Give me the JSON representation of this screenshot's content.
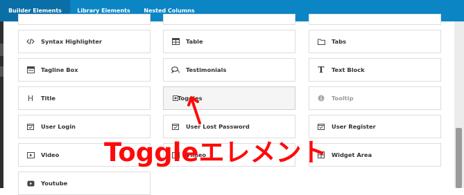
{
  "tabs": [
    {
      "label": "Builder Elements",
      "active": true
    },
    {
      "label": "Library Elements",
      "active": false
    },
    {
      "label": "Nested Columns",
      "active": false
    }
  ],
  "elements": [
    {
      "label": "Syntax Highlighter",
      "icon": "code-icon"
    },
    {
      "label": "Table",
      "icon": "table-icon"
    },
    {
      "label": "Tabs",
      "icon": "folder-icon"
    },
    {
      "label": "Tagline Box",
      "icon": "tagline-box-icon"
    },
    {
      "label": "Testimonials",
      "icon": "speech-bubbles-icon"
    },
    {
      "label": "Text Block",
      "icon": "text-t-icon"
    },
    {
      "label": "Title",
      "icon": "heading-h-icon"
    },
    {
      "label": "Toggles",
      "icon": "toggle-square-icon"
    },
    {
      "label": "Tooltip",
      "icon": "info-circle-icon"
    },
    {
      "label": "User Login",
      "icon": "calendar-check-icon"
    },
    {
      "label": "User Lost Password",
      "icon": "calendar-check-icon"
    },
    {
      "label": "User Register",
      "icon": "calendar-check-icon"
    },
    {
      "label": "Video",
      "icon": "video-icon"
    },
    {
      "label": "Vimeo",
      "icon": "vimeo-icon"
    },
    {
      "label": "Widget Area",
      "icon": "widget-icon"
    },
    {
      "label": "Youtube",
      "icon": "youtube-icon"
    }
  ],
  "overlay": {
    "text": "Toggleエレメント"
  },
  "colors": {
    "tabbar": "#0b85c4",
    "annotation": "#ff0a0a"
  }
}
